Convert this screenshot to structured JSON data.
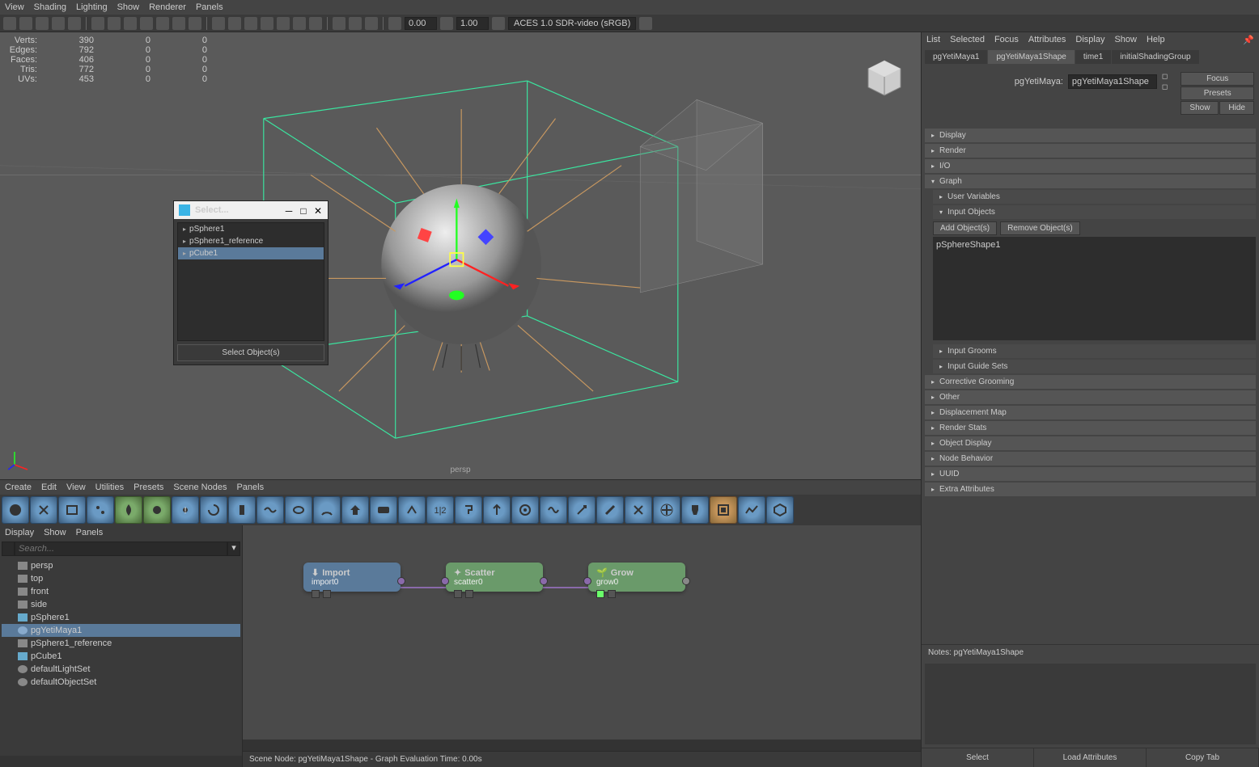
{
  "viewport_menu": [
    "View",
    "Shading",
    "Lighting",
    "Show",
    "Renderer",
    "Panels"
  ],
  "toolbar": {
    "num1": "0.00",
    "num2": "1.00",
    "colorspace": "ACES 1.0 SDR-video (sRGB)"
  },
  "stats": {
    "rows": [
      {
        "label": "Verts:",
        "a": "390",
        "b": "0",
        "c": "0"
      },
      {
        "label": "Edges:",
        "a": "792",
        "b": "0",
        "c": "0"
      },
      {
        "label": "Faces:",
        "a": "406",
        "b": "0",
        "c": "0"
      },
      {
        "label": "Tris:",
        "a": "772",
        "b": "0",
        "c": "0"
      },
      {
        "label": "UVs:",
        "a": "453",
        "b": "0",
        "c": "0"
      }
    ]
  },
  "persp": "persp",
  "select_dialog": {
    "title": "Select...",
    "items": [
      "pSphere1",
      "pSphere1_reference",
      "pCube1"
    ],
    "action": "Select Object(s)"
  },
  "right_panel": {
    "menu": [
      "List",
      "Selected",
      "Focus",
      "Attributes",
      "Display",
      "Show",
      "Help"
    ],
    "tabs": [
      "pgYetiMaya1",
      "pgYetiMaya1Shape",
      "time1",
      "initialShadingGroup"
    ],
    "name_label": "pgYetiMaya:",
    "name_value": "pgYetiMaya1Shape",
    "btns": {
      "focus": "Focus",
      "presets": "Presets",
      "show": "Show",
      "hide": "Hide"
    },
    "sections": {
      "display": "Display",
      "render": "Render",
      "io": "I/O",
      "graph": "Graph",
      "user_vars": "User Variables",
      "input_objects": "Input Objects",
      "add": "Add Object(s)",
      "remove": "Remove Object(s)",
      "obj_item": "pSphereShape1",
      "input_grooms": "Input Grooms",
      "input_guide": "Input Guide Sets",
      "corrective": "Corrective Grooming",
      "other": "Other",
      "displacement": "Displacement Map",
      "render_stats": "Render Stats",
      "obj_display": "Object Display",
      "node_behavior": "Node Behavior",
      "uuid": "UUID",
      "extra": "Extra Attributes"
    },
    "notes_label": "Notes: pgYetiMaya1Shape",
    "bottom": {
      "select": "Select",
      "load": "Load Attributes",
      "copy": "Copy Tab"
    }
  },
  "node_editor": {
    "menu": [
      "Create",
      "Edit",
      "View",
      "Utilities",
      "Presets",
      "Scene Nodes",
      "Panels"
    ],
    "left_menu": [
      "Display",
      "Show",
      "Panels"
    ],
    "search_placeholder": "Search...",
    "outliner": [
      {
        "name": "persp",
        "dim": true,
        "icon": "cam"
      },
      {
        "name": "top",
        "dim": true,
        "icon": "cam"
      },
      {
        "name": "front",
        "dim": true,
        "icon": "cam"
      },
      {
        "name": "side",
        "dim": true,
        "icon": "cam"
      },
      {
        "name": "pSphere1",
        "icon": "mesh"
      },
      {
        "name": "pgYetiMaya1",
        "sel": true,
        "icon": "yeti"
      },
      {
        "name": "pSphere1_reference",
        "dim": true,
        "icon": "mesh"
      },
      {
        "name": "pCube1",
        "icon": "mesh"
      },
      {
        "name": "defaultLightSet",
        "icon": "set"
      },
      {
        "name": "defaultObjectSet",
        "icon": "set"
      }
    ],
    "nodes": {
      "import": {
        "title": "Import",
        "sub": "import0"
      },
      "scatter": {
        "title": "Scatter",
        "sub": "scatter0"
      },
      "grow": {
        "title": "Grow",
        "sub": "grow0"
      }
    },
    "status": "Scene Node: pgYetiMaya1Shape - Graph Evaluation Time: 0.00s"
  }
}
